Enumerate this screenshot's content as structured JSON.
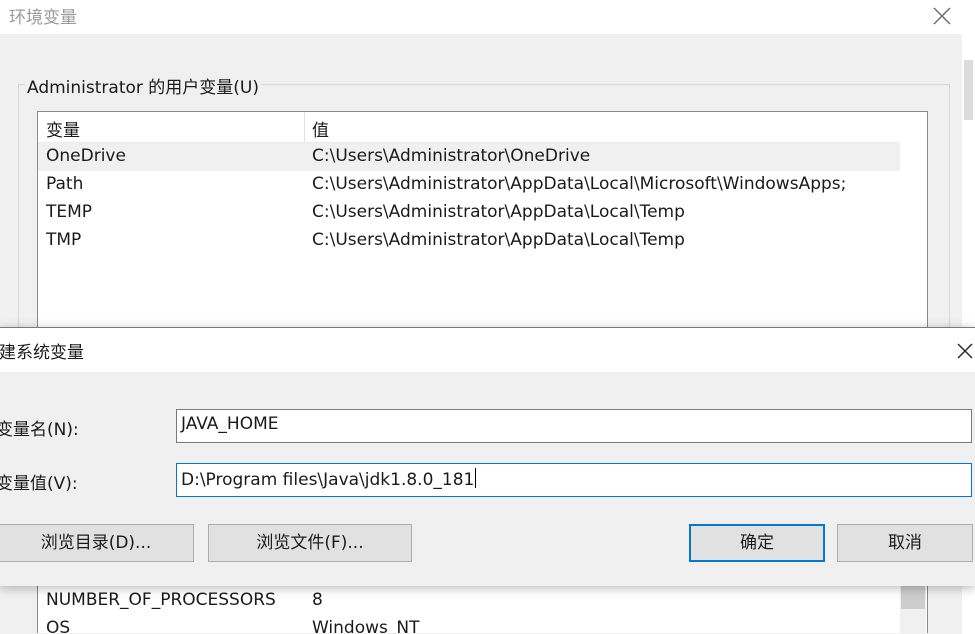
{
  "env_window": {
    "title": "环境变量",
    "user_group_label": "Administrator 的用户变量(U)",
    "user_table": {
      "headers": [
        "变量",
        "值"
      ],
      "rows": [
        {
          "name": "OneDrive",
          "value": "C:\\Users\\Administrator\\OneDrive"
        },
        {
          "name": "Path",
          "value": "C:\\Users\\Administrator\\AppData\\Local\\Microsoft\\WindowsApps;"
        },
        {
          "name": "TEMP",
          "value": "C:\\Users\\Administrator\\AppData\\Local\\Temp"
        },
        {
          "name": "TMP",
          "value": "C:\\Users\\Administrator\\AppData\\Local\\Temp"
        }
      ]
    },
    "system_table": {
      "rows": [
        {
          "name": "NUMBER_OF_PROCESSORS",
          "value": "8"
        },
        {
          "name": "OS",
          "value": "Windows_NT"
        }
      ]
    }
  },
  "new_var_dialog": {
    "title": "建系统变量",
    "name_label": "变量名(N):",
    "name_value": "JAVA_HOME",
    "value_label": "变量值(V):",
    "value_value": "D:\\Program files\\Java\\jdk1.8.0_181",
    "browse_dir_label": "浏览目录(D)...",
    "browse_file_label": "浏览文件(F)...",
    "ok_label": "确定",
    "cancel_label": "取消"
  },
  "icons": {
    "window_close": "close-icon",
    "dialog_close": "close-icon"
  },
  "colors": {
    "focus_accent": "#0078d7",
    "window_bg": "#f0f0f0",
    "selected_row": "#f0f0f0"
  }
}
